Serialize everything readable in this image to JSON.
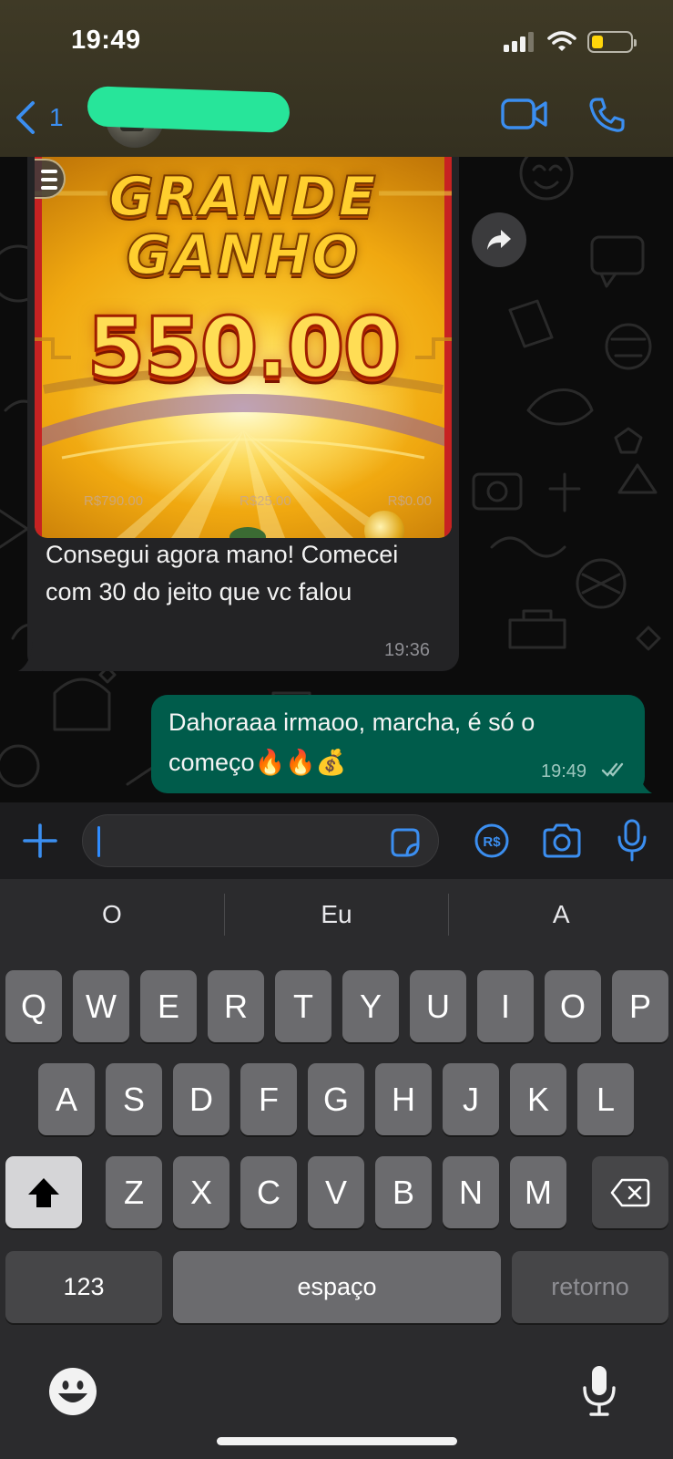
{
  "status_bar": {
    "time": "19:49"
  },
  "header": {
    "back_count": "1",
    "contact_name": ""
  },
  "messages": {
    "received": {
      "image": {
        "title_line1": "GRANDE",
        "title_line2": "GANHO",
        "amount": "550.00",
        "stats": [
          "R$790.00",
          "R$25.00",
          "R$0.00"
        ]
      },
      "caption": "Consegui agora mano! Comecei com 30 do jeito que vc falou",
      "time": "19:36"
    },
    "sent": {
      "text": "Dahoraaa irmaoo, marcha, é só o começo🔥🔥💰",
      "time": "19:49"
    }
  },
  "composer": {
    "input_value": ""
  },
  "keyboard": {
    "suggestions": [
      "O",
      "Eu",
      "A"
    ],
    "row1": [
      "Q",
      "W",
      "E",
      "R",
      "T",
      "Y",
      "U",
      "I",
      "O",
      "P"
    ],
    "row2": [
      "A",
      "S",
      "D",
      "F",
      "G",
      "H",
      "J",
      "K",
      "L"
    ],
    "row3": [
      "Z",
      "X",
      "C",
      "V",
      "B",
      "N",
      "M"
    ],
    "numbers_label": "123",
    "space_label": "espaço",
    "return_label": "retorno"
  },
  "icons": {
    "accent": "#3b8ef0",
    "sent_bubble": "#005c4b",
    "received_bubble": "#232325"
  }
}
